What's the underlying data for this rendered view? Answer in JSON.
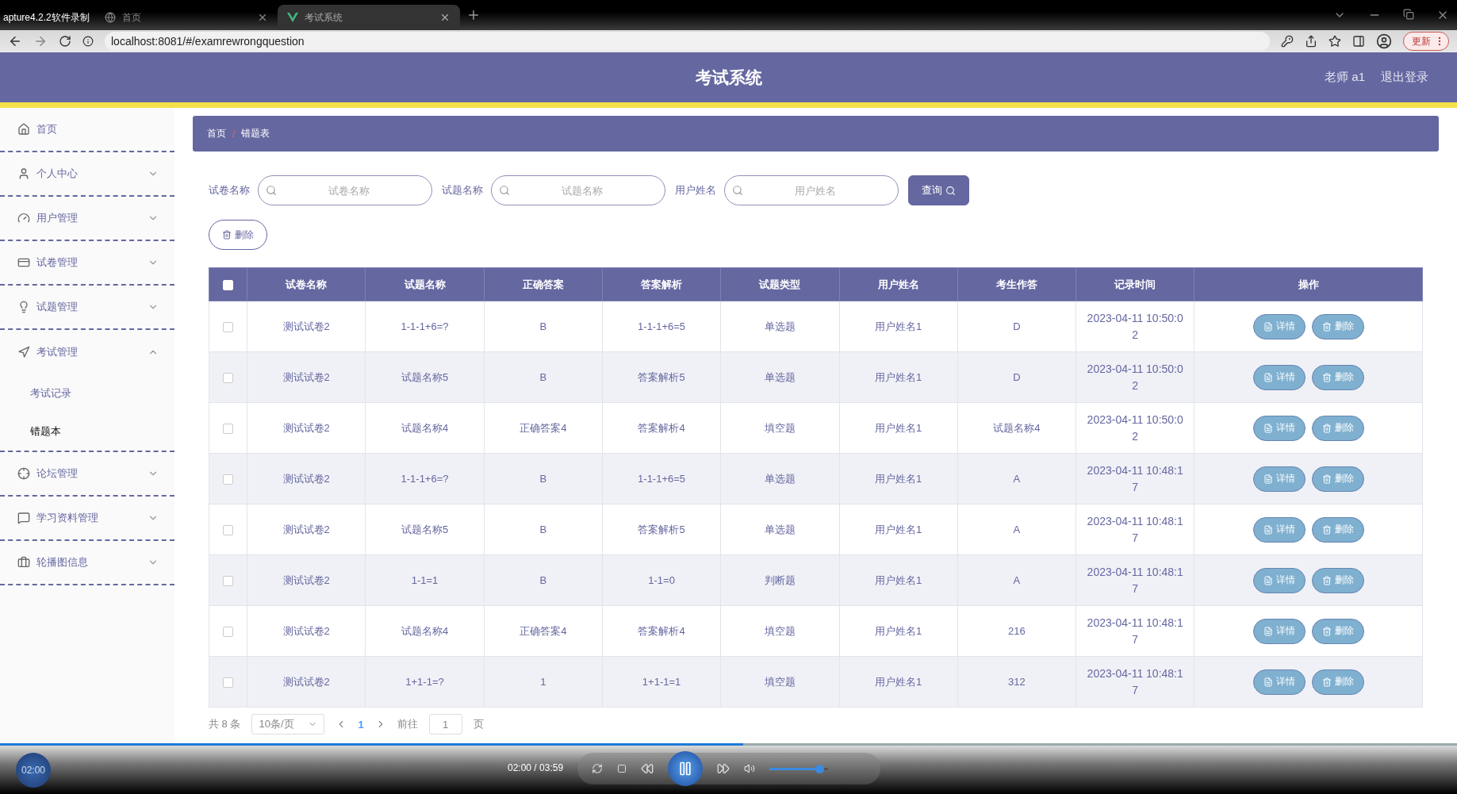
{
  "browser": {
    "tabs": [
      {
        "title": "apture4.2.2软件录制",
        "selected": false
      },
      {
        "title": "首页",
        "selected": false
      },
      {
        "title": "考试系统",
        "selected": true
      }
    ],
    "url": "localhost:8081/#/examrewrongquestion",
    "update_button": "更新"
  },
  "header": {
    "title": "考试系统",
    "user": "老师 a1",
    "logout": "退出登录"
  },
  "sidebar": [
    {
      "label": "首页",
      "kind": "link"
    },
    {
      "label": "个人中心",
      "kind": "menu",
      "expanded": false
    },
    {
      "label": "用户管理",
      "kind": "menu",
      "expanded": false
    },
    {
      "label": "试卷管理",
      "kind": "menu",
      "expanded": false
    },
    {
      "label": "试题管理",
      "kind": "menu",
      "expanded": false
    },
    {
      "label": "考试管理",
      "kind": "menu",
      "expanded": true,
      "children": [
        {
          "label": "考试记录",
          "selected": false
        },
        {
          "label": "错题本",
          "selected": true
        }
      ]
    },
    {
      "label": "论坛管理",
      "kind": "menu",
      "expanded": false
    },
    {
      "label": "学习资料管理",
      "kind": "menu",
      "expanded": false
    },
    {
      "label": "轮播图信息",
      "kind": "menu",
      "expanded": false
    }
  ],
  "breadcrumb": [
    "首页",
    "错题表"
  ],
  "breadcrumb_separator": "/",
  "search": {
    "fields": [
      {
        "label": "试卷名称",
        "placeholder": "试卷名称"
      },
      {
        "label": "试题名称",
        "placeholder": "试题名称"
      },
      {
        "label": "用户姓名",
        "placeholder": "用户姓名"
      }
    ],
    "button": "查询"
  },
  "delete_button": "删除",
  "table": {
    "header_checked": false,
    "columns": [
      "试卷名称",
      "试题名称",
      "正确答案",
      "答案解析",
      "试题类型",
      "用户姓名",
      "考生作答",
      "记录时间",
      "操作"
    ],
    "rows": [
      {
        "checked": false,
        "cells": [
          "测试试卷2",
          "1-1-1+6=?",
          "B",
          "1-1-1+6=5",
          "单选题",
          "用户姓名1",
          "D",
          "2023-04-11 10:50:02"
        ],
        "actions": [
          "详情",
          "删除"
        ]
      },
      {
        "checked": false,
        "cells": [
          "测试试卷2",
          "试题名称5",
          "B",
          "答案解析5",
          "单选题",
          "用户姓名1",
          "D",
          "2023-04-11 10:50:02"
        ],
        "actions": [
          "详情",
          "删除"
        ]
      },
      {
        "checked": false,
        "cells": [
          "测试试卷2",
          "试题名称4",
          "正确答案4",
          "答案解析4",
          "填空题",
          "用户姓名1",
          "试题名称4",
          "2023-04-11 10:50:02"
        ],
        "actions": [
          "详情",
          "删除"
        ]
      },
      {
        "checked": false,
        "cells": [
          "测试试卷2",
          "1-1-1+6=?",
          "B",
          "1-1-1+6=5",
          "单选题",
          "用户姓名1",
          "A",
          "2023-04-11 10:48:17"
        ],
        "actions": [
          "详情",
          "删除"
        ]
      },
      {
        "checked": false,
        "cells": [
          "测试试卷2",
          "试题名称5",
          "B",
          "答案解析5",
          "单选题",
          "用户姓名1",
          "A",
          "2023-04-11 10:48:17"
        ],
        "actions": [
          "详情",
          "删除"
        ]
      },
      {
        "checked": false,
        "cells": [
          "测试试卷2",
          "1-1=1",
          "B",
          "1-1=0",
          "判断题",
          "用户姓名1",
          "A",
          "2023-04-11 10:48:17"
        ],
        "actions": [
          "详情",
          "删除"
        ]
      },
      {
        "checked": false,
        "cells": [
          "测试试卷2",
          "试题名称4",
          "正确答案4",
          "答案解析4",
          "填空题",
          "用户姓名1",
          "216",
          "2023-04-11 10:48:17"
        ],
        "actions": [
          "详情",
          "删除"
        ]
      },
      {
        "checked": false,
        "cells": [
          "测试试卷2",
          "1+1-1=?",
          "1",
          "1+1-1=1",
          "填空题",
          "用户姓名1",
          "312",
          "2023-04-11 10:48:17"
        ],
        "actions": [
          "详情",
          "删除"
        ]
      }
    ]
  },
  "pagination": {
    "total": "共 8 条",
    "page_size": "10条/页",
    "pages": [
      {
        "label": "1",
        "selected": true
      }
    ],
    "goto_label": "前往",
    "goto_value": "1",
    "goto_suffix": "页"
  },
  "player": {
    "elapsed_badge": "02:00",
    "time": "02:00 / 03:59",
    "progress": {
      "level": 0.51
    },
    "volume": {
      "level": 0.85
    }
  }
}
